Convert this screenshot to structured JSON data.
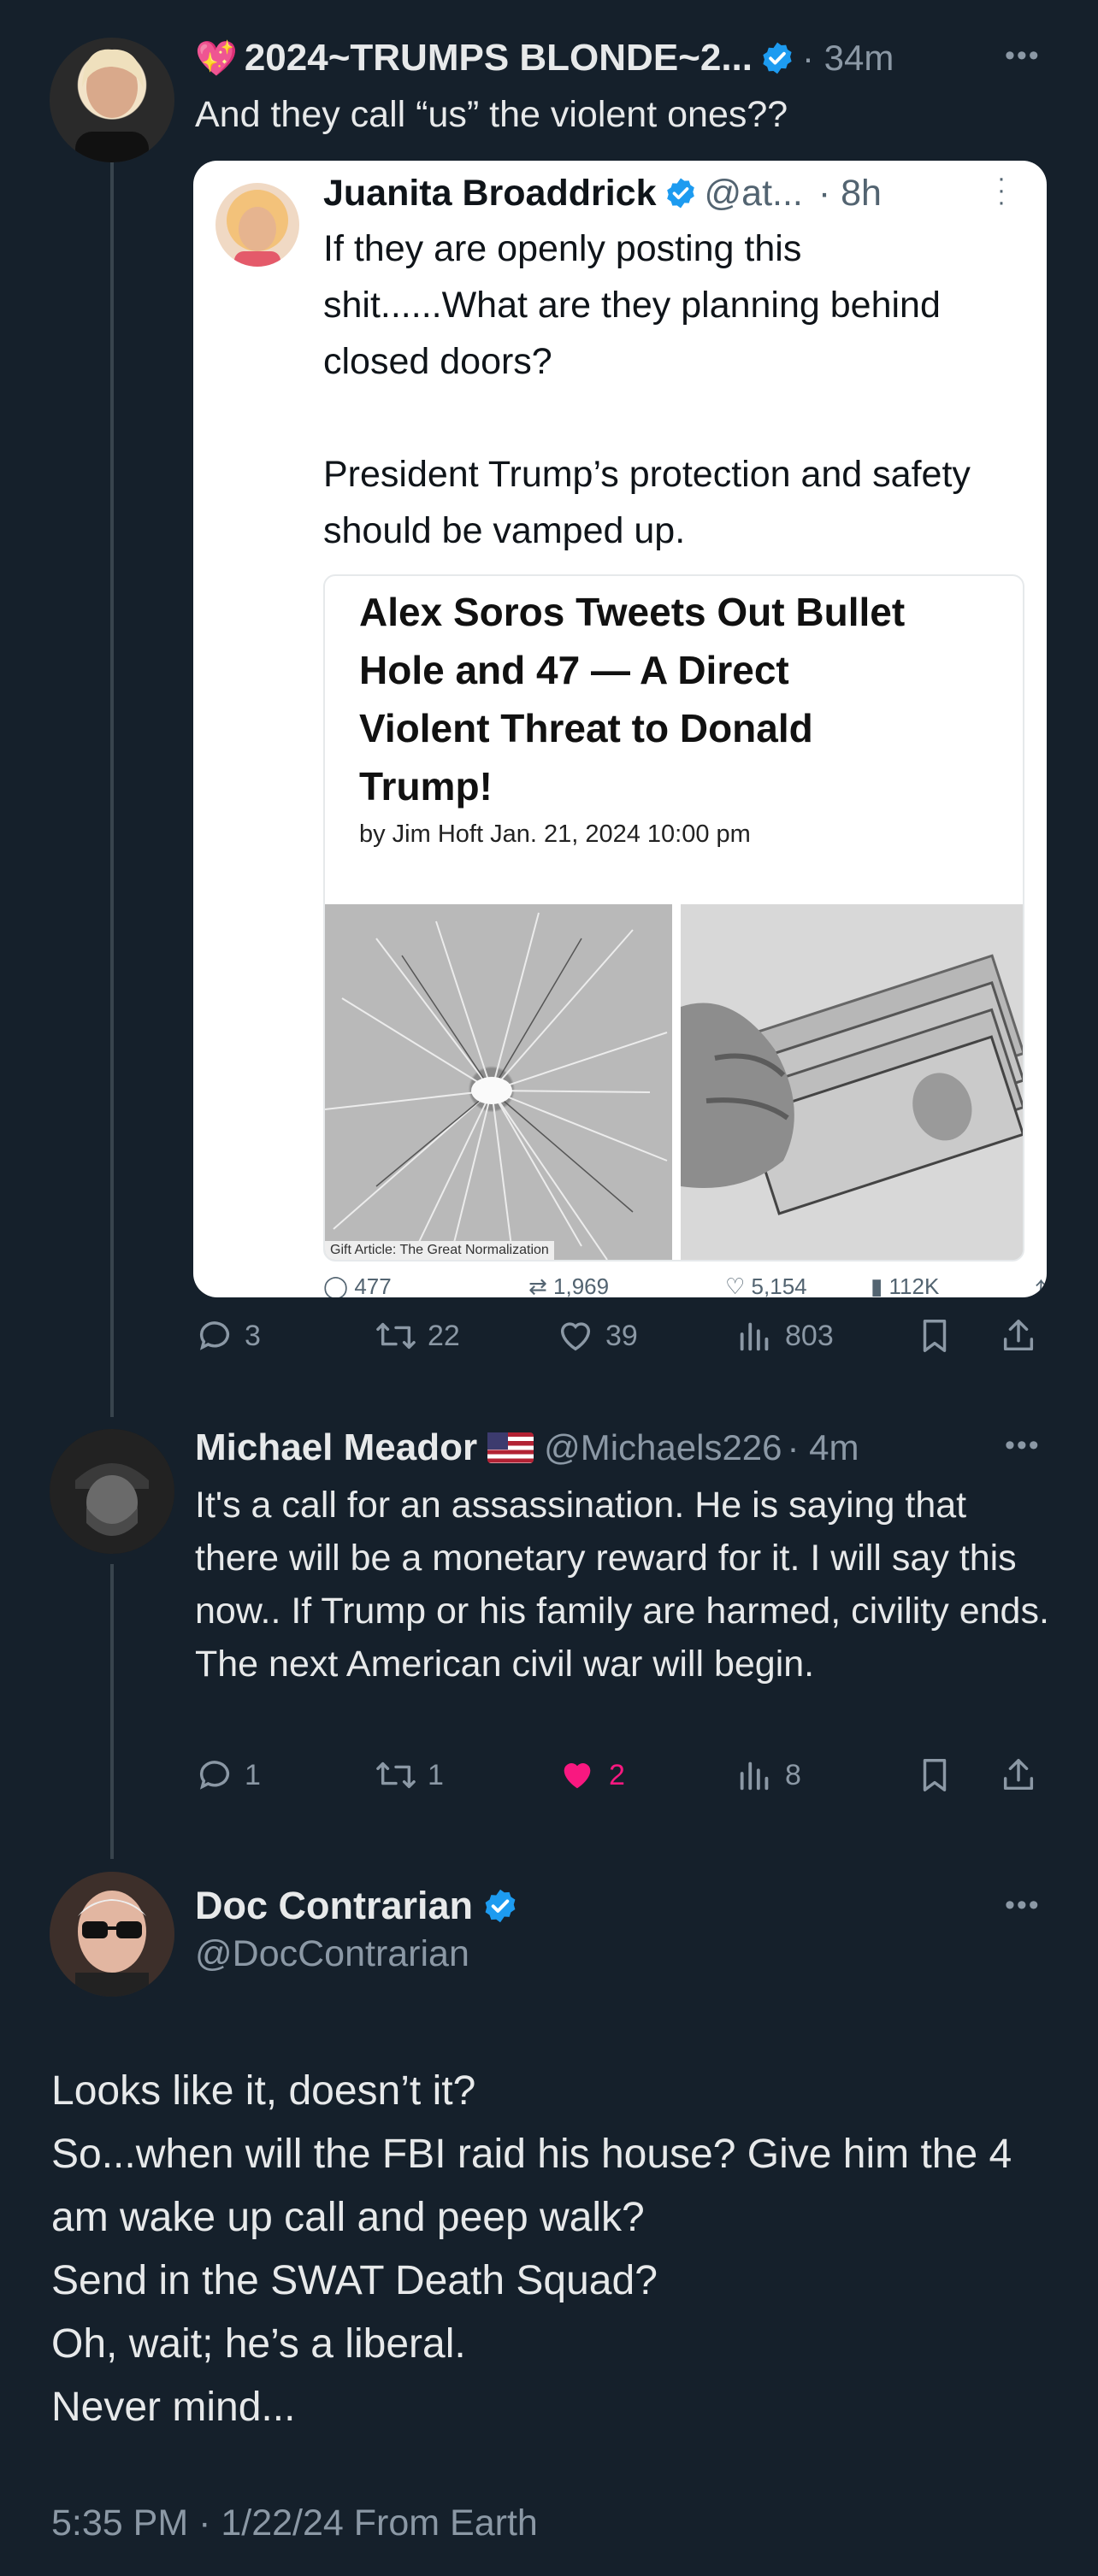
{
  "post1": {
    "emoji": "💖",
    "author": "2024~TRUMPS BLONDE~2...",
    "time": "· 34m",
    "text": "And they call “us” the violent ones??",
    "quote": {
      "author": "Juanita Broaddrick",
      "handle": "@at...",
      "time": "· 8h",
      "text": "If they are openly posting this shit......What are they planning behind closed doors?\n\nPresident Trump’s protection and safety should be vamped up.",
      "article": {
        "headline": "Alex Soros Tweets Out Bullet Hole and 47 — A Direct Violent Threat to Donald Trump!",
        "byline": "by Jim Hoft Jan. 21, 2024 10:00 pm",
        "caption": "Gift Article: The Great Normalization"
      },
      "stats": {
        "replies": "477",
        "retweets": "1,969",
        "likes": "5,154",
        "views": "112K"
      }
    },
    "stats": {
      "replies": "3",
      "retweets": "22",
      "likes": "39",
      "views": "803"
    }
  },
  "post2": {
    "author": "Michael Meador",
    "flag": "🇺🇸",
    "handle": "@Michaels226",
    "time": "· 4m",
    "text": "It's a call for an assassination.  He is saying that there will be a monetary reward for it.  I will say this now.. If Trump or his family are harmed, civility ends.  The next American civil war will begin.",
    "stats": {
      "replies": "1",
      "retweets": "1",
      "likes": "2",
      "views": "8"
    },
    "like_color": "#f91880"
  },
  "main_post": {
    "author": "Doc Contrarian",
    "handle": "@DocContrarian",
    "text": "Looks like it, doesn’t it?\nSo...when will the FBI raid his house? Give him the 4 am wake up call and peep walk?\nSend in the SWAT Death Squad?\nOh, wait; he’s a liberal.\nNever mind...",
    "timestamp": "5:35 PM · 1/22/24 From Earth"
  },
  "colors": {
    "background": "#15202b",
    "verified": "#1d9bf0",
    "muted": "#8b98a5",
    "like_active": "#f91880"
  },
  "icons": [
    "reply-icon",
    "retweet-icon",
    "like-icon",
    "views-icon",
    "bookmark-icon",
    "share-icon",
    "more-icon",
    "verified-icon"
  ]
}
